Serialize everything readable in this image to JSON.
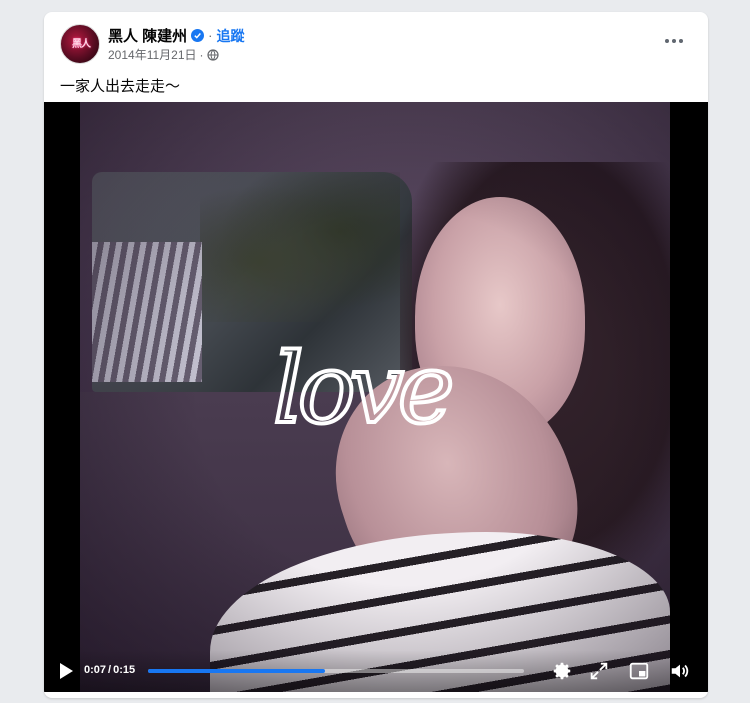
{
  "post": {
    "author": "黑人 陳建州",
    "verified": true,
    "separator": "·",
    "follow_label": "追蹤",
    "date": "2014年11月21日",
    "date_separator": "·",
    "audience_icon": "globe-icon",
    "more_icon": "more-options-icon",
    "caption": "一家人出去走走～",
    "avatar_text": "黑人"
  },
  "video": {
    "overlay_text": "love",
    "current_time": "0:07",
    "time_separator": "/",
    "duration": "0:15",
    "progress": 0.47,
    "controls": {
      "play_icon": "play-icon",
      "settings_icon": "settings-gear-icon",
      "fullscreen_icon": "fullscreen-icon",
      "pip_icon": "picture-in-picture-icon",
      "volume_icon": "volume-icon"
    }
  },
  "colors": {
    "accent": "#1877f2",
    "text_primary": "#050505",
    "text_secondary": "#65676b",
    "page_background": "#e9ebee",
    "card_background": "#ffffff"
  }
}
